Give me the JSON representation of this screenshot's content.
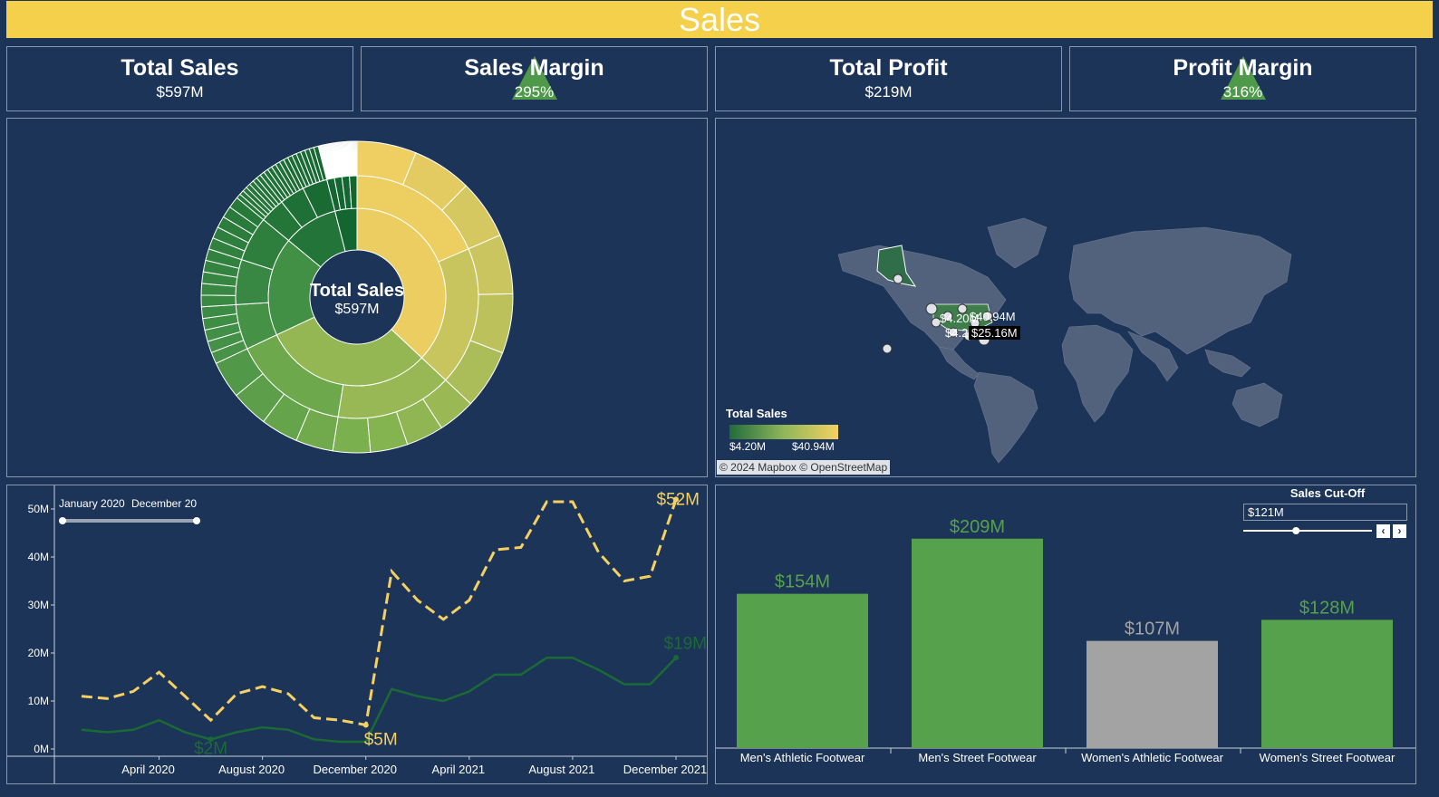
{
  "header": {
    "title": "Sales"
  },
  "kpis": [
    {
      "title": "Total Sales",
      "value": "$597M",
      "indicator": false
    },
    {
      "title": "Sales Margin",
      "value": "295%",
      "indicator": true
    },
    {
      "title": "Total Profit",
      "value": "$219M",
      "indicator": false
    },
    {
      "title": "Profit Margin",
      "value": "316%",
      "indicator": true
    }
  ],
  "colors": {
    "background": "#1c3457",
    "header": "#f5d04a",
    "series_total": "#f5d062",
    "series_profit": "#1a6a35",
    "bar_above_cutoff": "#56a14c",
    "bar_below_cutoff": "#a3a3a3"
  },
  "sunburst": {
    "center_title": "Total Sales",
    "center_value": "$597M"
  },
  "map": {
    "legend_title": "Total Sales",
    "legend_min": "$4.20M",
    "legend_max": "$40.94M",
    "attribution": "© 2024 Mapbox © OpenStreetMap",
    "data_labels": [
      "$4.20M",
      "$40.94M",
      "$4.20M",
      "$25.16M"
    ]
  },
  "line_chart": {
    "slider_start": "January 2020",
    "slider_end": "December 20",
    "chart_data": {
      "type": "line",
      "x": [
        "2020-01",
        "2020-02",
        "2020-03",
        "2020-04",
        "2020-05",
        "2020-06",
        "2020-07",
        "2020-08",
        "2020-09",
        "2020-10",
        "2020-11",
        "2020-12",
        "2021-01",
        "2021-02",
        "2021-03",
        "2021-04",
        "2021-05",
        "2021-06",
        "2021-07",
        "2021-08",
        "2021-09",
        "2021-10",
        "2021-11",
        "2021-12"
      ],
      "x_tick_labels": [
        "April 2020",
        "August 2020",
        "December 2020",
        "April 2021",
        "August 2021",
        "December 2021"
      ],
      "y_tick_labels": [
        "0M",
        "10M",
        "20M",
        "30M",
        "40M",
        "50M"
      ],
      "ylim": [
        0,
        50
      ],
      "series": [
        {
          "values": [
            11,
            10.5,
            12,
            16,
            11,
            6,
            11.5,
            13,
            11.5,
            6.5,
            6,
            5,
            37,
            31,
            27,
            31,
            41.5,
            42,
            51.5,
            51.5,
            41,
            35,
            36,
            52
          ]
        },
        {
          "values": [
            4,
            3.5,
            4,
            6,
            3.5,
            2,
            3.5,
            4.5,
            4,
            2,
            1.5,
            1.5,
            12.5,
            11,
            10,
            12,
            15.5,
            15.5,
            19,
            19,
            16.5,
            13.5,
            13.5,
            19
          ]
        }
      ],
      "annotations": [
        {
          "label": "$52M",
          "x": "2021-12"
        },
        {
          "label": "$5M",
          "x": "2020-12"
        },
        {
          "label": "$19M",
          "x": "2021-12"
        },
        {
          "label": "$2M",
          "x": "2020-06"
        }
      ],
      "xlabel": "",
      "ylabel": ""
    }
  },
  "bar_chart": {
    "cutoff_title": "Sales Cut-Off",
    "cutoff_value": "$121M",
    "cutoff_slider_fraction": 0.41,
    "chart_data": {
      "type": "bar",
      "categories": [
        "Men's Athletic Footwear",
        "Men's Street Footwear",
        "Women's Athletic Footwear",
        "Women's Street Footwear"
      ],
      "values": [
        154,
        209,
        107,
        128
      ],
      "value_labels": [
        "$154M",
        "$209M",
        "$107M",
        "$128M"
      ],
      "ylim": [
        0,
        235
      ],
      "title": "",
      "xlabel": "",
      "ylabel": ""
    }
  }
}
